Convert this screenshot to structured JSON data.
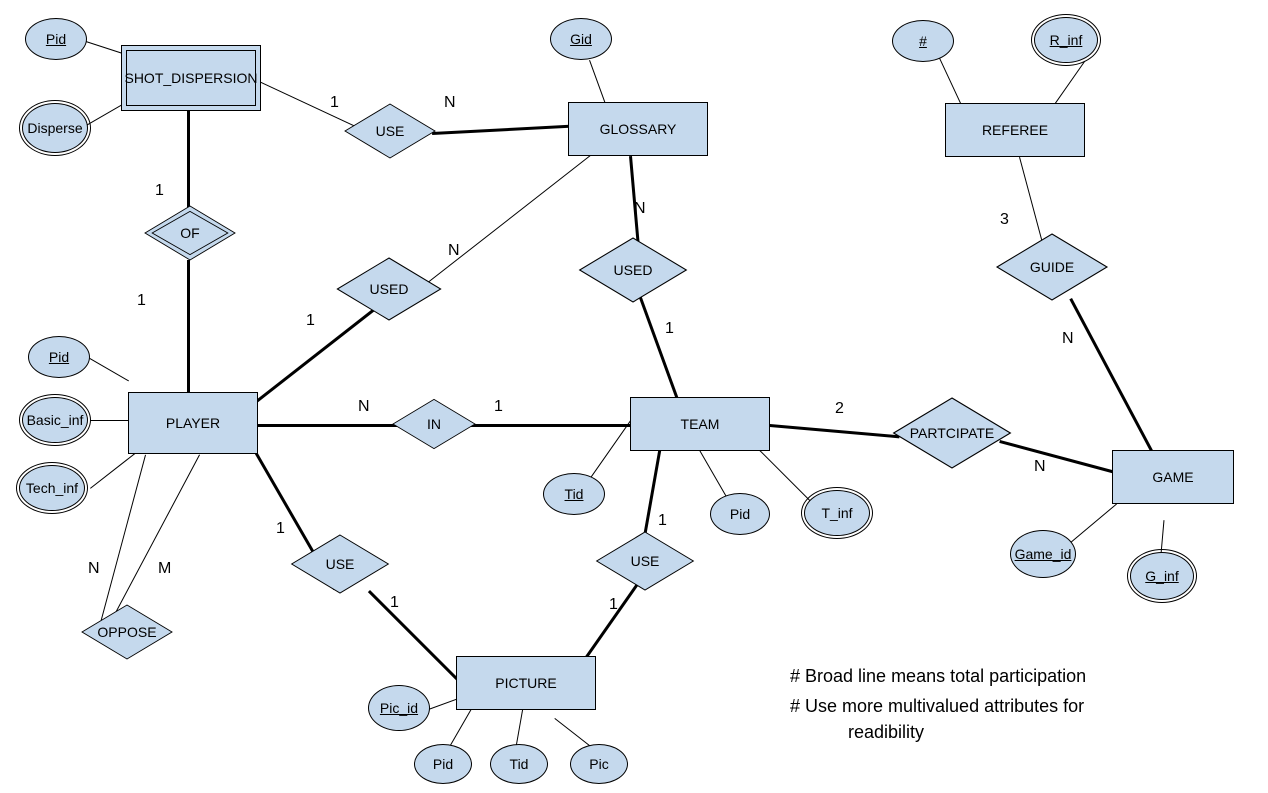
{
  "entities": {
    "shot_dispersion": "SHOT_DISPERSION",
    "glossary": "GLOSSARY",
    "referee": "REFEREE",
    "player": "PLAYER",
    "team": "TEAM",
    "game": "GAME",
    "picture": "PICTURE"
  },
  "relationships": {
    "use1": "USE",
    "of": "OF",
    "used1": "USED",
    "used2": "USED",
    "in": "IN",
    "use2": "USE",
    "use3": "USE",
    "oppose": "OPPOSE",
    "guide": "GUIDE",
    "participate": "PARTCIPATE"
  },
  "attributes": {
    "sd_pid": "Pid",
    "sd_disperse": "Disperse",
    "g_gid": "Gid",
    "r_num": "#",
    "r_inf": "R_inf",
    "p_pid": "Pid",
    "p_basic": "Basic_inf",
    "p_tech": "Tech_inf",
    "t_tid": "Tid",
    "t_pid": "Pid",
    "t_inf": "T_inf",
    "gm_id": "Game_id",
    "gm_inf": "G_inf",
    "pic_id": "Pic_id",
    "pic_pid": "Pid",
    "pic_tid": "Tid",
    "pic_pic": "Pic"
  },
  "cardinalities": {
    "c1": "1",
    "c2": "N",
    "c3": "1",
    "c4": "1",
    "c5": "N",
    "c6": "1",
    "c7": "N",
    "c8": "1",
    "c9": "N",
    "c10": "1",
    "c11": "1",
    "c12": "1",
    "c13": "1",
    "c14": "1",
    "c15": "N",
    "c16": "M",
    "c17": "2",
    "c18": "N",
    "c19": "3",
    "c20": "N"
  },
  "notes": {
    "n1": "# Broad line means  total participation",
    "n2": "# Use more multivalued attributes for",
    "n3": "readibility"
  }
}
